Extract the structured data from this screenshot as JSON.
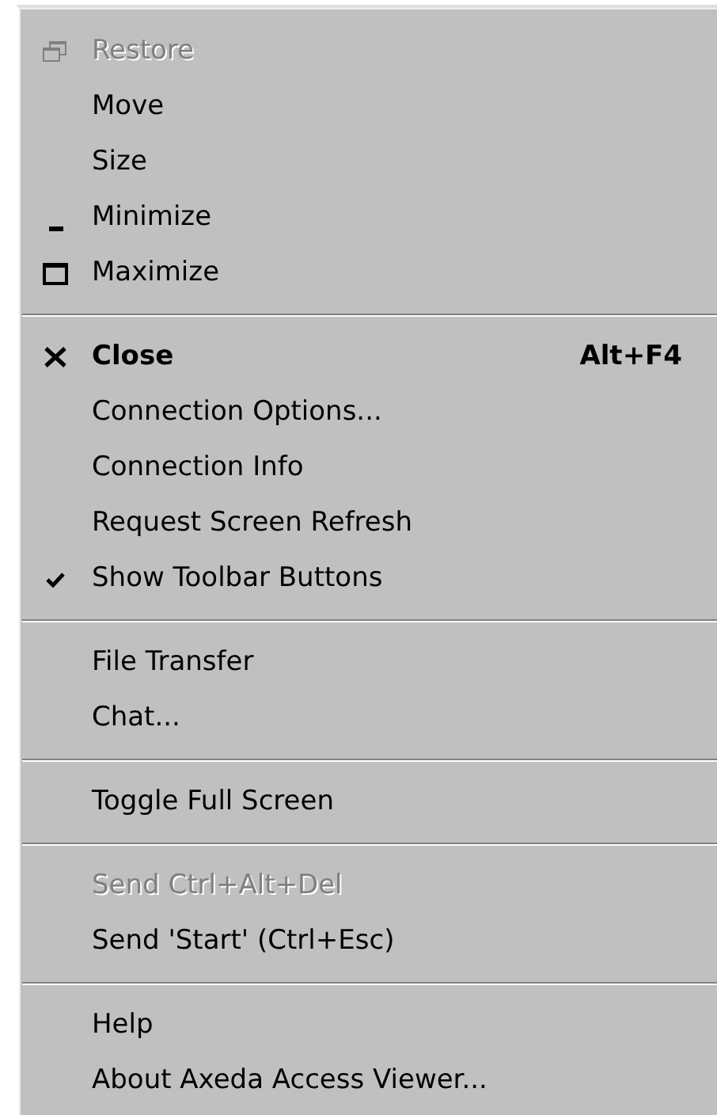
{
  "sections": [
    {
      "items": [
        {
          "label": "Restore",
          "kind": "restore",
          "disabled": true,
          "checked": false,
          "default": false
        },
        {
          "label": "Move",
          "kind": "plain",
          "disabled": false,
          "checked": false,
          "default": false
        },
        {
          "label": "Size",
          "kind": "plain",
          "disabled": false,
          "checked": false,
          "default": false
        },
        {
          "label": "Minimize",
          "kind": "minimize",
          "disabled": false,
          "checked": false,
          "default": false
        },
        {
          "label": "Maximize",
          "kind": "maximize",
          "disabled": false,
          "checked": false,
          "default": false
        }
      ]
    },
    {
      "items": [
        {
          "label": "Close",
          "kind": "close",
          "shortcut": "Alt+F4",
          "disabled": false,
          "checked": false,
          "default": true
        },
        {
          "label": "Connection Options...",
          "kind": "plain",
          "disabled": false,
          "checked": false,
          "default": false
        },
        {
          "label": "Connection Info",
          "kind": "plain",
          "disabled": false,
          "checked": false,
          "default": false
        },
        {
          "label": "Request Screen Refresh",
          "kind": "plain",
          "disabled": false,
          "checked": false,
          "default": false
        },
        {
          "label": "Show Toolbar Buttons",
          "kind": "plain",
          "disabled": false,
          "checked": true,
          "default": false
        }
      ]
    },
    {
      "items": [
        {
          "label": "File Transfer",
          "kind": "plain",
          "disabled": false,
          "checked": false,
          "default": false
        },
        {
          "label": "Chat...",
          "kind": "plain",
          "disabled": false,
          "checked": false,
          "default": false
        }
      ]
    },
    {
      "items": [
        {
          "label": "Toggle Full Screen",
          "kind": "plain",
          "disabled": false,
          "checked": false,
          "default": false
        }
      ]
    },
    {
      "items": [
        {
          "label": "Send Ctrl+Alt+Del",
          "kind": "plain",
          "disabled": true,
          "checked": false,
          "default": false
        },
        {
          "label": "Send 'Start' (Ctrl+Esc)",
          "kind": "plain",
          "disabled": false,
          "checked": false,
          "default": false
        }
      ]
    },
    {
      "items": [
        {
          "label": "Help",
          "kind": "plain",
          "disabled": false,
          "checked": false,
          "default": false
        },
        {
          "label": "About Axeda Access Viewer...",
          "kind": "plain",
          "disabled": false,
          "checked": false,
          "default": false
        }
      ]
    }
  ]
}
